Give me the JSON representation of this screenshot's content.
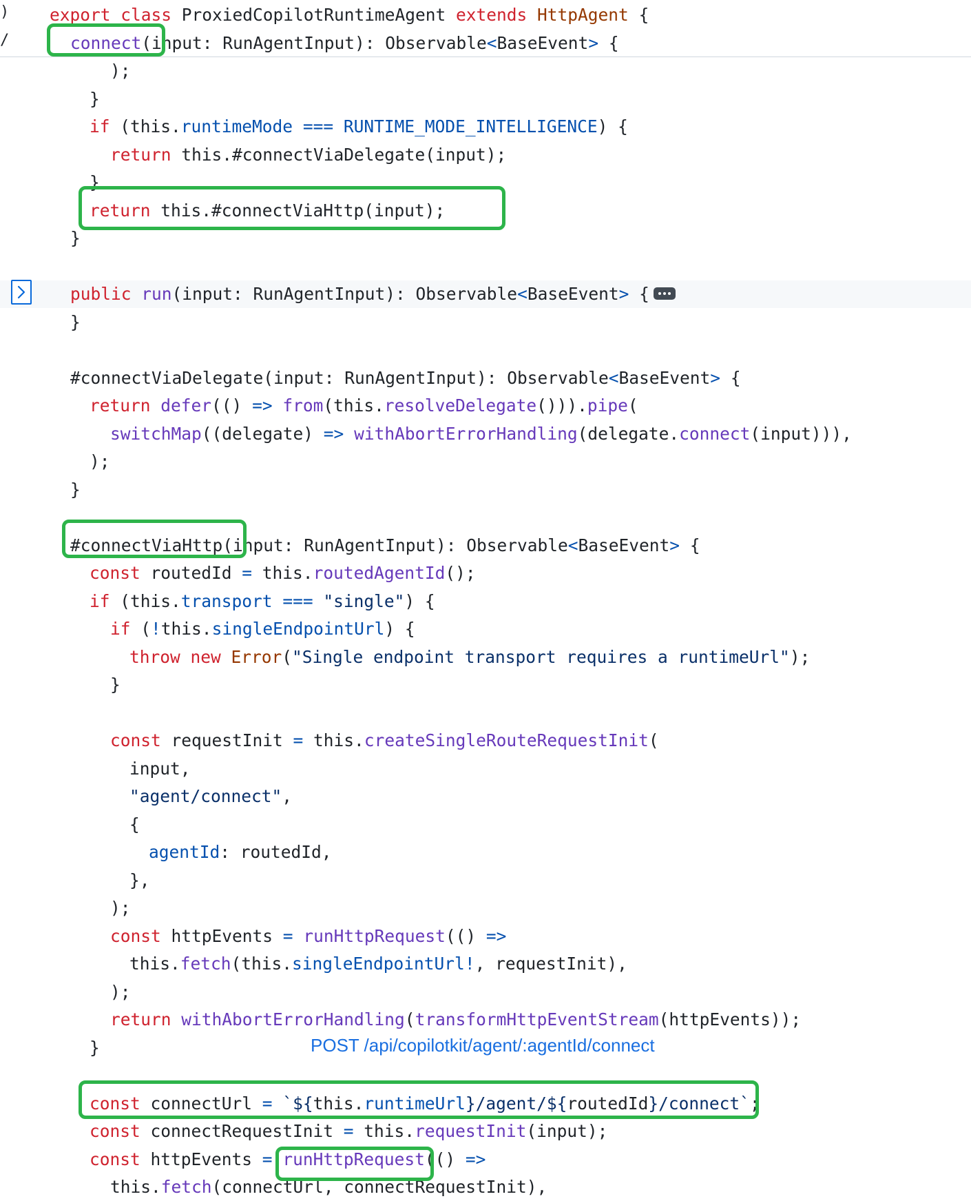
{
  "left_margin_marks": [
    ")",
    "/"
  ],
  "code_lines": [
    {
      "tokens": [
        [
          "kw",
          "export class "
        ],
        [
          "txt",
          "ProxiedCopilotRuntimeAgent "
        ],
        [
          "kw",
          "extends "
        ],
        [
          "type",
          "HttpAgent"
        ],
        [
          "txt",
          " {"
        ]
      ]
    },
    {
      "tokens": [
        [
          "fn",
          "connect"
        ],
        [
          "txt",
          "(input: RunAgentInput): Observable"
        ],
        [
          "op",
          "<"
        ],
        [
          "txt",
          "BaseEvent"
        ],
        [
          "op",
          ">"
        ],
        [
          "txt",
          " {"
        ]
      ]
    },
    {
      "tokens": [
        [
          "txt",
          ");"
        ]
      ]
    },
    {
      "tokens": [
        [
          "txt",
          "}"
        ]
      ]
    },
    {
      "tokens": [
        [
          "kw",
          "if"
        ],
        [
          "txt",
          " (this."
        ],
        [
          "prop",
          "runtimeMode"
        ],
        [
          "txt",
          " "
        ],
        [
          "op",
          "==="
        ],
        [
          "txt",
          " "
        ],
        [
          "prop",
          "RUNTIME_MODE_INTELLIGENCE"
        ],
        [
          "txt",
          ") {"
        ]
      ]
    },
    {
      "tokens": [
        [
          "kw",
          "return"
        ],
        [
          "txt",
          " this.#connectViaDelegate(input);"
        ]
      ]
    },
    {
      "tokens": [
        [
          "txt",
          "}"
        ]
      ]
    },
    {
      "tokens": [
        [
          "kw",
          "return"
        ],
        [
          "txt",
          " this.#connectViaHttp(input);"
        ]
      ]
    },
    {
      "tokens": [
        [
          "txt",
          "}"
        ]
      ]
    },
    {
      "tokens": []
    },
    {
      "tokens": [
        [
          "kw",
          "public"
        ],
        [
          "txt",
          " "
        ],
        [
          "fn",
          "run"
        ],
        [
          "txt",
          "(input: RunAgentInput): Observable"
        ],
        [
          "op",
          "<"
        ],
        [
          "txt",
          "BaseEvent"
        ],
        [
          "op",
          ">"
        ],
        [
          "txt",
          " {"
        ]
      ]
    },
    {
      "tokens": [
        [
          "txt",
          "}"
        ]
      ]
    },
    {
      "tokens": []
    },
    {
      "tokens": [
        [
          "txt",
          "#connectViaDelegate(input: RunAgentInput): Observable"
        ],
        [
          "op",
          "<"
        ],
        [
          "txt",
          "BaseEvent"
        ],
        [
          "op",
          ">"
        ],
        [
          "txt",
          " {"
        ]
      ]
    },
    {
      "tokens": [
        [
          "kw",
          "return"
        ],
        [
          "txt",
          " "
        ],
        [
          "fn",
          "defer"
        ],
        [
          "txt",
          "(() "
        ],
        [
          "op",
          "=>"
        ],
        [
          "txt",
          " "
        ],
        [
          "fn",
          "from"
        ],
        [
          "txt",
          "(this."
        ],
        [
          "fn",
          "resolveDelegate"
        ],
        [
          "txt",
          "()))."
        ],
        [
          "fn",
          "pipe"
        ],
        [
          "txt",
          "("
        ]
      ]
    },
    {
      "tokens": [
        [
          "fn",
          "switchMap"
        ],
        [
          "txt",
          "((delegate) "
        ],
        [
          "op",
          "=>"
        ],
        [
          "txt",
          " "
        ],
        [
          "fn",
          "withAbortErrorHandling"
        ],
        [
          "txt",
          "(delegate."
        ],
        [
          "fn",
          "connect"
        ],
        [
          "txt",
          "(input))),"
        ]
      ]
    },
    {
      "tokens": [
        [
          "txt",
          ");"
        ]
      ]
    },
    {
      "tokens": [
        [
          "txt",
          "}"
        ]
      ]
    },
    {
      "tokens": []
    },
    {
      "tokens": [
        [
          "txt",
          "#connectViaHttp(input: RunAgentInput): Observable"
        ],
        [
          "op",
          "<"
        ],
        [
          "txt",
          "BaseEvent"
        ],
        [
          "op",
          ">"
        ],
        [
          "txt",
          " {"
        ]
      ]
    },
    {
      "tokens": [
        [
          "kw",
          "const"
        ],
        [
          "txt",
          " routedId "
        ],
        [
          "op",
          "="
        ],
        [
          "txt",
          " this."
        ],
        [
          "fn",
          "routedAgentId"
        ],
        [
          "txt",
          "();"
        ]
      ]
    },
    {
      "tokens": [
        [
          "kw",
          "if"
        ],
        [
          "txt",
          " (this."
        ],
        [
          "prop",
          "transport"
        ],
        [
          "txt",
          " "
        ],
        [
          "op",
          "==="
        ],
        [
          "txt",
          " "
        ],
        [
          "str",
          "\"single\""
        ],
        [
          "txt",
          ") {"
        ]
      ]
    },
    {
      "tokens": [
        [
          "kw",
          "if"
        ],
        [
          "txt",
          " ("
        ],
        [
          "op",
          "!"
        ],
        [
          "txt",
          "this."
        ],
        [
          "prop",
          "singleEndpointUrl"
        ],
        [
          "txt",
          ") {"
        ]
      ]
    },
    {
      "tokens": [
        [
          "kw",
          "throw new "
        ],
        [
          "type",
          "Error"
        ],
        [
          "txt",
          "("
        ],
        [
          "str",
          "\"Single endpoint transport requires a runtimeUrl\""
        ],
        [
          "txt",
          ");"
        ]
      ]
    },
    {
      "tokens": [
        [
          "txt",
          "}"
        ]
      ]
    },
    {
      "tokens": []
    },
    {
      "tokens": [
        [
          "kw",
          "const"
        ],
        [
          "txt",
          " requestInit "
        ],
        [
          "op",
          "="
        ],
        [
          "txt",
          " this."
        ],
        [
          "fn",
          "createSingleRouteRequestInit"
        ],
        [
          "txt",
          "("
        ]
      ]
    },
    {
      "tokens": [
        [
          "txt",
          "input,"
        ]
      ]
    },
    {
      "tokens": [
        [
          "str",
          "\"agent/connect\""
        ],
        [
          "txt",
          ","
        ]
      ]
    },
    {
      "tokens": [
        [
          "txt",
          "{"
        ]
      ]
    },
    {
      "tokens": [
        [
          "prop",
          "agentId"
        ],
        [
          "txt",
          ": routedId,"
        ]
      ]
    },
    {
      "tokens": [
        [
          "txt",
          "},"
        ]
      ]
    },
    {
      "tokens": [
        [
          "txt",
          ");"
        ]
      ]
    },
    {
      "tokens": [
        [
          "kw",
          "const"
        ],
        [
          "txt",
          " httpEvents "
        ],
        [
          "op",
          "="
        ],
        [
          "txt",
          " "
        ],
        [
          "fn",
          "runHttpRequest"
        ],
        [
          "txt",
          "(() "
        ],
        [
          "op",
          "=>"
        ]
      ]
    },
    {
      "tokens": [
        [
          "txt",
          "this."
        ],
        [
          "fn",
          "fetch"
        ],
        [
          "txt",
          "(this."
        ],
        [
          "prop",
          "singleEndpointUrl"
        ],
        [
          "op",
          "!"
        ],
        [
          "txt",
          ", requestInit),"
        ]
      ]
    },
    {
      "tokens": [
        [
          "txt",
          ");"
        ]
      ]
    },
    {
      "tokens": [
        [
          "kw",
          "return"
        ],
        [
          "txt",
          " "
        ],
        [
          "fn",
          "withAbortErrorHandling"
        ],
        [
          "txt",
          "("
        ],
        [
          "fn",
          "transformHttpEventStream"
        ],
        [
          "txt",
          "(httpEvents));"
        ]
      ]
    },
    {
      "tokens": [
        [
          "txt",
          "}"
        ]
      ]
    },
    {
      "tokens": []
    },
    {
      "tokens": [
        [
          "kw",
          "const"
        ],
        [
          "txt",
          " connectUrl "
        ],
        [
          "op",
          "="
        ],
        [
          "txt",
          " "
        ],
        [
          "str",
          "`${"
        ],
        [
          "txt",
          "this."
        ],
        [
          "prop",
          "runtimeUrl"
        ],
        [
          "str",
          "}/agent/${"
        ],
        [
          "txt",
          "routedId"
        ],
        [
          "str",
          "}/connect`"
        ],
        [
          "txt",
          ";"
        ]
      ]
    },
    {
      "tokens": [
        [
          "kw",
          "const"
        ],
        [
          "txt",
          " connectRequestInit "
        ],
        [
          "op",
          "="
        ],
        [
          "txt",
          " this."
        ],
        [
          "fn",
          "requestInit"
        ],
        [
          "txt",
          "(input);"
        ]
      ]
    },
    {
      "tokens": [
        [
          "kw",
          "const"
        ],
        [
          "txt",
          " httpEvents "
        ],
        [
          "op",
          "="
        ],
        [
          "txt",
          " "
        ],
        [
          "fn",
          "runHttpRequest"
        ],
        [
          "txt",
          "(() "
        ],
        [
          "op",
          "=>"
        ]
      ]
    },
    {
      "tokens": [
        [
          "txt",
          "this."
        ],
        [
          "fn",
          "fetch"
        ],
        [
          "txt",
          "(connectUrl, connectRequestInit),"
        ]
      ]
    }
  ],
  "annotation": {
    "text": "POST /api/copilotkit/agent/:agentId/connect"
  },
  "colors": {
    "keyword": "#cf222e",
    "type": "#953800",
    "function": "#6639ba",
    "property": "#0550ae",
    "string": "#0a3069",
    "text": "#1f2328",
    "highlight_box": "#2db44a",
    "annotation": "#1a6fe0",
    "fold_button": "#0969da"
  },
  "icons": {
    "fold_toggle": "chevron-right-icon",
    "collapsed_body": "ellipsis-icon"
  }
}
